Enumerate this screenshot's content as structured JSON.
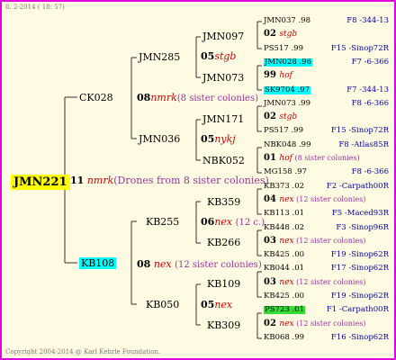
{
  "header": {
    "date": "8. 2-2014 ( 18: 57)"
  },
  "footer": {
    "copyright": "Copyright 2004-2014 @ Karl Kehrle Foundation."
  },
  "colors": {
    "frame": "#e000e0",
    "background": "#fffbe3",
    "line": "#333333",
    "code": "#cc0000",
    "note": "#993399",
    "link": "#0000aa"
  },
  "root": {
    "name": "JMN221",
    "gen_num": "11",
    "code": "nmrk",
    "note": "(Drones from 8 sister colonies)"
  },
  "l1": [
    {
      "name": "CK028",
      "gen_num": "08",
      "code": "nmrk",
      "note": "(8 sister colonies)"
    },
    {
      "name": "KB108",
      "gen_num": "08",
      "code": "nex",
      "note": "(12 sister colonies)"
    }
  ],
  "l2": [
    {
      "name": "JMN285",
      "gen_num": "05",
      "code": "stgb",
      "note": ""
    },
    {
      "name": "JMN036",
      "gen_num": "05",
      "code": "nykj",
      "note": ""
    },
    {
      "name": "KB255",
      "gen_num": "06",
      "code": "nex",
      "note": "(12 c.)"
    },
    {
      "name": "KB050",
      "gen_num": "05",
      "code": "nex",
      "note": ""
    }
  ],
  "l3": [
    "JMN097",
    "JMN073",
    "JMN171",
    "NBK052",
    "KB359",
    "KB266",
    "KB109",
    "KB309"
  ],
  "l4": [
    {
      "text": "JMN037 .98",
      "ref": "F8 -344-13"
    },
    {
      "num": "02",
      "code": "stgb",
      "note": ""
    },
    {
      "text": "PS517 .99",
      "ref": "F15 -Sinop72R"
    },
    {
      "text": "JMN028 .96",
      "ref": "F7 -6-366",
      "hl": "cyan"
    },
    {
      "num": "99",
      "code": "hof",
      "note": ""
    },
    {
      "text": "SK9704 .97",
      "ref": "F7 -344-13",
      "hl": "cyan"
    },
    {
      "text": "JMN073 .99",
      "ref": "F8 -6-366"
    },
    {
      "num": "02",
      "code": "stgb",
      "note": ""
    },
    {
      "text": "PS517 .99",
      "ref": "F15 -Sinop72R"
    },
    {
      "text": "NBK048 .99",
      "ref": "F8 -Atlas85R"
    },
    {
      "num": "01",
      "code": "hof",
      "note": "(8 sister colonies)"
    },
    {
      "text": "MG158 .97",
      "ref": "F8 -6-366"
    },
    {
      "text": "KB373 .02",
      "ref": "F2 -Carpath00R"
    },
    {
      "num": "04",
      "code": "nex",
      "note": "(12 sister colonies)"
    },
    {
      "text": "KB113 .01",
      "ref": "F5 -Maced93R"
    },
    {
      "text": "KB448 .02",
      "ref": "F3 -Sinop96R"
    },
    {
      "num": "03",
      "code": "nex",
      "note": "(12 sister colonies)"
    },
    {
      "text": "KB425 .00",
      "ref": "F19 -Sinop62R"
    },
    {
      "text": "KB044 .01",
      "ref": "F17 -Sinop62R"
    },
    {
      "num": "03",
      "code": "nex",
      "note": "(12 sister colonies)"
    },
    {
      "text": "KB425 .00",
      "ref": "F19 -Sinop62R"
    },
    {
      "text": "PS723 .01",
      "ref": "F1 -Carpath00R",
      "hl": "green"
    },
    {
      "num": "02",
      "code": "nex",
      "note": "(12 sister colonies)"
    },
    {
      "text": "KB068 .99",
      "ref": "F16 -Sinop62R"
    }
  ]
}
